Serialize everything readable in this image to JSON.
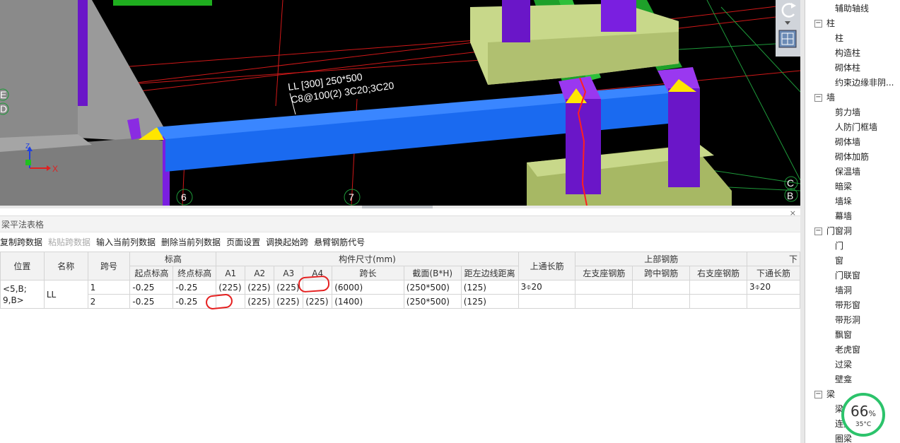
{
  "viewport": {
    "beam_annotation_line1": "LL [300] 250*500",
    "beam_annotation_line2": "C8@100(2) 3C20;3C20",
    "axis_labels": {
      "left_top": "E",
      "left_bottom": "D",
      "right_top": "C",
      "right_bottom": "B",
      "bottom_6": "6",
      "bottom_7": "7"
    },
    "coord_x": "X",
    "coord_z": "Z"
  },
  "panel": {
    "title": "梁平法表格",
    "close": "×",
    "toolbar": [
      "复制跨数据",
      "粘贴跨数据",
      "输入当前列数据",
      "删除当前列数据",
      "页面设置",
      "调换起始跨",
      "悬臂钢筋代号"
    ],
    "toolbar_disabled": [
      1
    ],
    "headers_top": {
      "position": "位置",
      "name": "名称",
      "span": "跨号",
      "elevation": "标高",
      "member_size": "构件尺寸(mm)",
      "top_through": "上通长筋",
      "top_rebar": "上部钢筋",
      "bottom": "下"
    },
    "headers_sub": [
      "起点标高",
      "终点标高",
      "A1",
      "A2",
      "A3",
      "A4",
      "跨长",
      "截面(B*H)",
      "距左边线距离",
      "左支座钢筋",
      "跨中钢筋",
      "右支座钢筋",
      "下通长筋"
    ],
    "rows": [
      {
        "position": "<5,B;\n9,B>",
        "name": "LL",
        "span": "1",
        "start_elev": "-0.25",
        "end_elev": "-0.25",
        "a1": "(225)",
        "a2": "(225)",
        "a3": "(225)",
        "a4": "",
        "length": "(6000)",
        "section": "(250*500)",
        "offset": "(125)",
        "top_through": "3⌽20",
        "left_sup": "",
        "mid": "",
        "right_sup": "",
        "bottom_through": "3⌽20"
      },
      {
        "span": "2",
        "start_elev": "-0.25",
        "end_elev": "-0.25",
        "a1": "",
        "a2": "(225)",
        "a3": "(225)",
        "a4": "(225)",
        "length": "(1400)",
        "section": "(250*500)",
        "offset": "(125)",
        "top_through": "",
        "left_sup": "",
        "mid": "",
        "right_sup": "",
        "bottom_through": ""
      }
    ]
  },
  "tree": {
    "items": [
      {
        "type": "leaf",
        "label": "辅助轴线"
      },
      {
        "type": "cat",
        "label": "柱",
        "toggle": "−"
      },
      {
        "type": "leaf",
        "label": "柱"
      },
      {
        "type": "leaf",
        "label": "构造柱"
      },
      {
        "type": "leaf",
        "label": "砌体柱"
      },
      {
        "type": "leaf",
        "label": "约束边缘非阴..."
      },
      {
        "type": "cat",
        "label": "墙",
        "toggle": "−"
      },
      {
        "type": "leaf",
        "label": "剪力墙"
      },
      {
        "type": "leaf",
        "label": "人防门框墙"
      },
      {
        "type": "leaf",
        "label": "砌体墙"
      },
      {
        "type": "leaf",
        "label": "砌体加筋"
      },
      {
        "type": "leaf",
        "label": "保温墙"
      },
      {
        "type": "leaf",
        "label": "暗梁"
      },
      {
        "type": "leaf",
        "label": "墙垛"
      },
      {
        "type": "leaf",
        "label": "幕墙"
      },
      {
        "type": "cat",
        "label": "门窗洞",
        "toggle": "−"
      },
      {
        "type": "leaf",
        "label": "门"
      },
      {
        "type": "leaf",
        "label": "窗"
      },
      {
        "type": "leaf",
        "label": "门联窗"
      },
      {
        "type": "leaf",
        "label": "墙洞"
      },
      {
        "type": "leaf",
        "label": "带形窗"
      },
      {
        "type": "leaf",
        "label": "带形洞"
      },
      {
        "type": "leaf",
        "label": "飘窗"
      },
      {
        "type": "leaf",
        "label": "老虎窗"
      },
      {
        "type": "leaf",
        "label": "过梁"
      },
      {
        "type": "leaf",
        "label": "壁龛"
      },
      {
        "type": "cat",
        "label": "梁",
        "toggle": "−"
      },
      {
        "type": "leaf",
        "label": "梁"
      },
      {
        "type": "leaf",
        "label": "连梁"
      },
      {
        "type": "leaf",
        "label": "圈梁"
      }
    ]
  },
  "gauge": {
    "percent": "66",
    "percent_sign": "%",
    "temp": "35°C"
  }
}
